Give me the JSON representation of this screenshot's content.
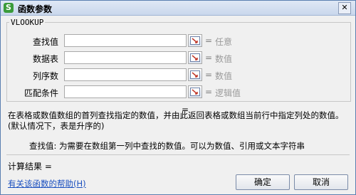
{
  "window": {
    "title": "函数参数",
    "close_label": "✕",
    "app_icon_label": "S"
  },
  "group": {
    "function_name": "VLOOKUP"
  },
  "params": [
    {
      "label": "查找值",
      "value": "",
      "eq": "=",
      "hint": "任意"
    },
    {
      "label": "数据表",
      "value": "",
      "eq": "=",
      "hint": "数值"
    },
    {
      "label": "列序数",
      "value": "",
      "eq": "=",
      "hint": "数值"
    },
    {
      "label": "匹配条件",
      "value": "",
      "eq": "=",
      "hint": "逻辑值"
    }
  ],
  "result_eq": "=",
  "description": "在表格或数值数组的首列查找指定的数值，并由此返回表格或数组当前行中指定列处的数值。(默认情况下，表是升序的)",
  "arg_description": "查找值: 为需要在数组第一列中查找的数值。可以为数值、引用或文本字符串",
  "calc_result_label": "计算结果 =",
  "help_link": "有关该函数的帮助(H)",
  "buttons": {
    "ok": "确定",
    "cancel": "取消"
  }
}
